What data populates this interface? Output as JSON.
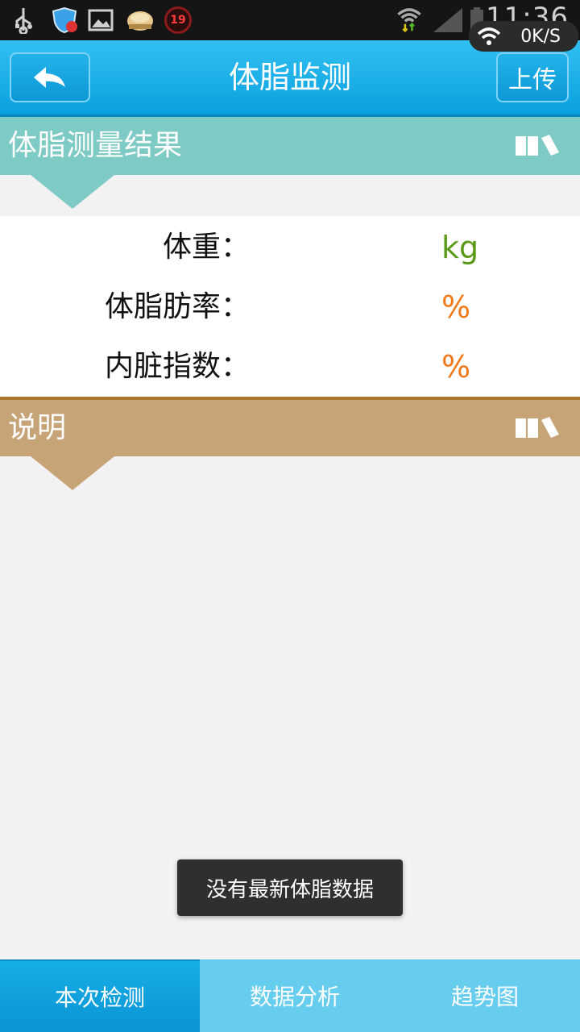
{
  "status_bar": {
    "time": "11:36",
    "net_speed": "0K/S",
    "badge_number": "19",
    "icons": [
      "usb-icon",
      "shield-icon",
      "image-icon",
      "food-icon",
      "badge-19-icon",
      "wifi-icon",
      "signal-icon",
      "battery-icon"
    ]
  },
  "header": {
    "title": "体脂监测",
    "upload_label": "上传",
    "back_icon": "back-arrow-icon"
  },
  "result_section": {
    "title": "体脂测量结果",
    "color": "#7ecac4",
    "rows": [
      {
        "label": "体重：",
        "value": "",
        "unit": "kg",
        "unit_color": "#5a9a17"
      },
      {
        "label": "体脂肪率：",
        "value": "",
        "unit": "%",
        "unit_color": "#f07a1a"
      },
      {
        "label": "内脏指数：",
        "value": "",
        "unit": "%",
        "unit_color": "#f07a1a"
      }
    ]
  },
  "description_section": {
    "title": "说明",
    "color": "#c7a478",
    "body": ""
  },
  "toast": {
    "message": "没有最新体脂数据"
  },
  "tabs": [
    {
      "label": "本次检测",
      "active": true
    },
    {
      "label": "数据分析",
      "active": false
    },
    {
      "label": "趋势图",
      "active": false
    }
  ]
}
